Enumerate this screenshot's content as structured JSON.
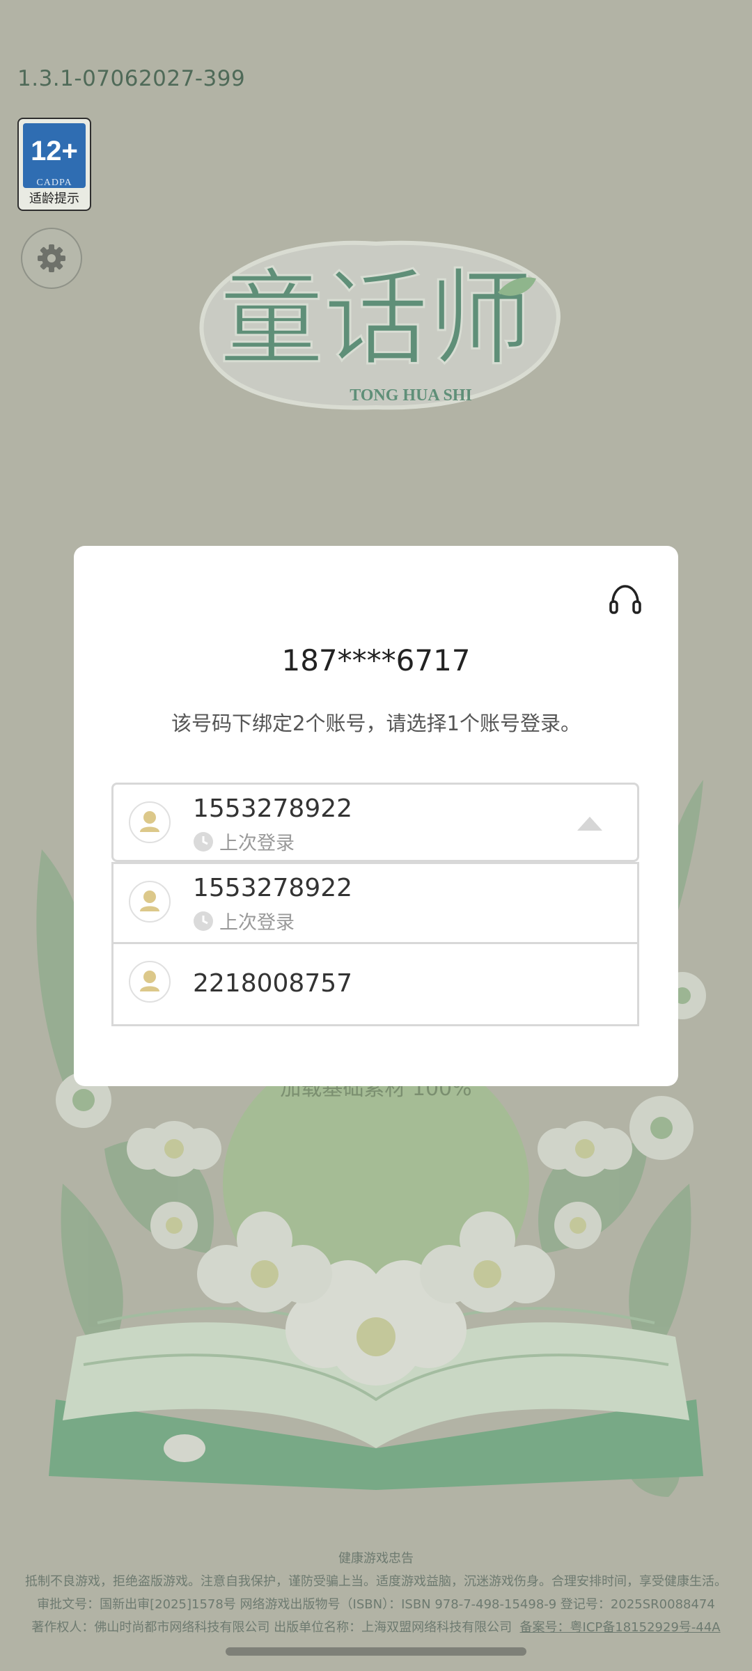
{
  "version": "1.3.1-07062027-399",
  "age_rating": {
    "age": "12+",
    "org": "CADPA",
    "tip": "适龄提示"
  },
  "logo": {
    "title": "童话师",
    "subtitle": "TONG HUA SHI"
  },
  "dialog": {
    "phone": "187****6717",
    "notice": "该号码下绑定2个账号，请选择1个账号登录。",
    "selected_account": {
      "id": "1553278922",
      "tag": "上次登录"
    },
    "accounts": [
      {
        "id": "1553278922",
        "tag": "上次登录"
      },
      {
        "id": "2218008757"
      }
    ]
  },
  "loading": {
    "text": "加载基础素材 100%"
  },
  "footer": {
    "title": "健康游戏忠告",
    "advice": "抵制不良游戏，拒绝盗版游戏。注意自我保护，谨防受骗上当。适度游戏益脑，沉迷游戏伤身。合理安排时间，享受健康生活。",
    "approval": "审批文号：国新出审[2025]1578号  网络游戏出版物号（ISBN）：ISBN 978-7-498-15498-9  登记号：2025SR0088474",
    "copyright": "著作权人：佛山时尚都市网络科技有限公司  出版单位名称：上海双盟网络科技有限公司",
    "icp": "备案号：粤ICP备18152929号-44A"
  },
  "colors": {
    "overlay": "#b2b3a5",
    "dialog_bg": "#ffffff",
    "badge_blue": "#2f6db2",
    "avatar_gold": "#dcc88a"
  }
}
